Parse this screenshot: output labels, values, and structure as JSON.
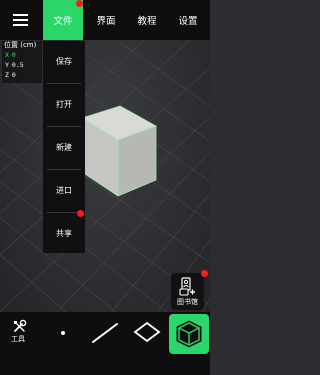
{
  "menu": {
    "icon": "hamburger-icon"
  },
  "tabs": [
    {
      "label": "文件",
      "active": true,
      "badge": true
    },
    {
      "label": "界面",
      "active": false,
      "badge": false
    },
    {
      "label": "教程",
      "active": false,
      "badge": false
    },
    {
      "label": "设置",
      "active": false,
      "badge": false
    }
  ],
  "position_panel": {
    "title": "位置 (cm)",
    "x_label": "X",
    "x_value": "0",
    "y_label": "Y",
    "y_value": "0.5",
    "z_label": "Z",
    "z_value": "0"
  },
  "file_menu": {
    "items": [
      "保存",
      "打开",
      "新建",
      "进口",
      "共享"
    ],
    "badge_on": "共享"
  },
  "library": {
    "label": "图书馆",
    "icon": "library-add-icon",
    "badge": true
  },
  "toolbar": {
    "tools_label": "工具",
    "tools_icon": "tools-icon",
    "items": [
      "point-tool-icon",
      "line-tool-icon",
      "plane-tool-icon",
      "cube-tool-icon"
    ],
    "selected": "cube-tool-icon"
  },
  "colors": {
    "accent": "#2bd66b",
    "badge": "#ff1a1a",
    "bar": "#0e0e0f"
  }
}
